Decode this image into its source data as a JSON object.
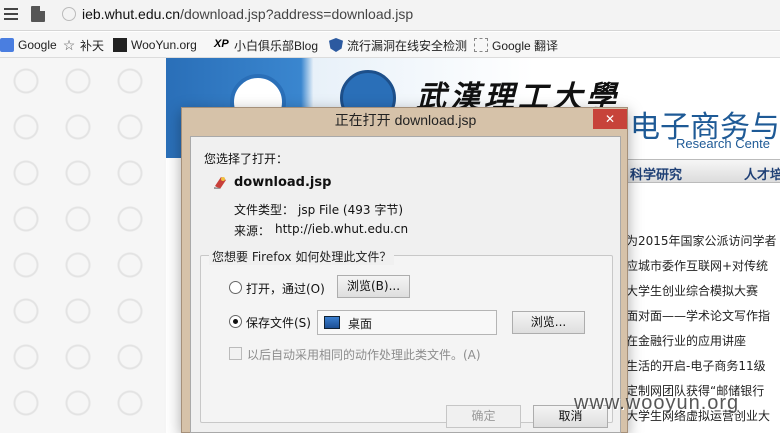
{
  "browser": {
    "url_host": "ieb.whut.edu.cn",
    "url_path": "/download.jsp?address=download.jsp",
    "bookmarks": [
      "Google",
      "补天",
      "WooYun.org",
      "小白俱乐部Blog",
      "流行漏洞在线安全检测",
      "Google 翻译"
    ],
    "bookmark_icons": [
      "google-icon",
      "star-icon",
      "wooyun-icon",
      "xp-icon",
      "shield-icon",
      "blank-page-icon"
    ]
  },
  "page": {
    "banner_calligraphy": "武漢理工大學",
    "banner_title": "电子商务与",
    "banner_subtitle": "Research Cente",
    "nav": [
      "科学研究",
      "人才培"
    ],
    "news": [
      "为2015年国家公派访问学者",
      "应城市委作互联网+对传统",
      "大学生创业综合模拟大赛",
      "面对面——学术论文写作指",
      "在金融行业的应用讲座",
      "生活的开启-电子商务11级",
      "定制网团队获得“邮储银行",
      "大学生网络虚拟运营创业大"
    ],
    "watermark": "www.wooyun.org"
  },
  "dialog": {
    "title": "正在打开 download.jsp",
    "close_glyph": "✕",
    "chosen_label": "您选择了打开：",
    "filename": "download.jsp",
    "filetype_label": "文件类型：",
    "filetype_value": "jsp File (493 字节)",
    "source_label": "来源：",
    "source_value": "http://ieb.whut.edu.cn",
    "group_legend": "您想要 Firefox 如何处理此文件？",
    "open_with_label": "打开，通过(O)",
    "save_label": "保存文件(S)",
    "open_with_selected": false,
    "save_selected": true,
    "browse_label_1": "浏览(B)...",
    "browse_label_2": "浏览...",
    "folder_value": "桌面",
    "auto_label": "以后自动采用相同的动作处理此类文件。(A)",
    "auto_checked": false,
    "ok_label": "确定",
    "cancel_label": "取消"
  },
  "colors": {
    "dialog_frame": "#d6c2a9",
    "close_button": "#c7433a",
    "banner_blue": "#2a6fb8"
  }
}
